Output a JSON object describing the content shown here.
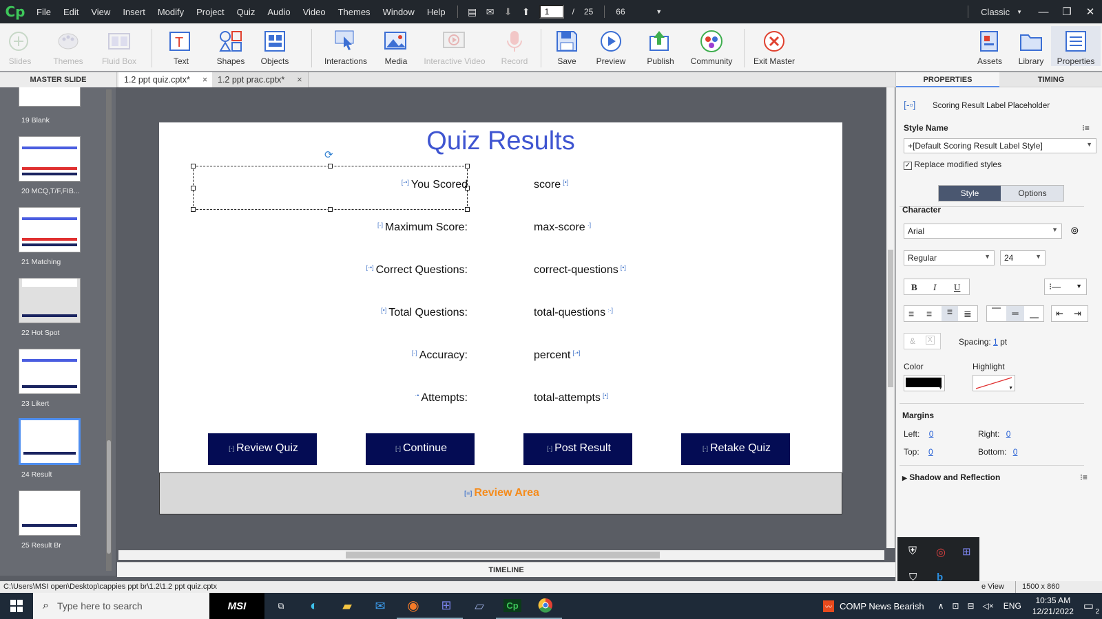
{
  "menubar": {
    "logo": "Cp",
    "items": [
      "File",
      "Edit",
      "View",
      "Insert",
      "Modify",
      "Project",
      "Quiz",
      "Audio",
      "Video",
      "Themes",
      "Window",
      "Help"
    ],
    "current_page": "1",
    "page_sep": "/",
    "total_pages": "25",
    "zoom": "66",
    "workspace": "Classic"
  },
  "toolbar": {
    "slides": "Slides",
    "themes": "Themes",
    "fluid_box": "Fluid Box",
    "text": "Text",
    "shapes": "Shapes",
    "objects": "Objects",
    "interactions": "Interactions",
    "media": "Media",
    "interactive_video": "Interactive Video",
    "record": "Record",
    "save": "Save",
    "preview": "Preview",
    "publish": "Publish",
    "community": "Community",
    "exit_master": "Exit Master",
    "assets": "Assets",
    "library": "Library",
    "properties": "Properties"
  },
  "tabs": {
    "master_slide": "MASTER SLIDE",
    "doc1": "1.2 ppt quiz.cptx*",
    "doc2": "1.2 ppt prac.cptx*",
    "close": "×"
  },
  "filmstrip": [
    {
      "label": "19 Blank"
    },
    {
      "label": "20 MCQ,T/F,FIB..."
    },
    {
      "label": "21 Matching"
    },
    {
      "label": "22 Hot Spot"
    },
    {
      "label": "23 Likert"
    },
    {
      "label": "24 Result"
    },
    {
      "label": "25 Result Br"
    }
  ],
  "slide": {
    "title": "Quiz Results",
    "rows": [
      {
        "label": "You Scored",
        "value": "score"
      },
      {
        "label": "Maximum Score:",
        "value": "max-score"
      },
      {
        "label": "Correct Questions:",
        "value": "correct-questions"
      },
      {
        "label": "Total Questions:",
        "value": "total-questions"
      },
      {
        "label": "Accuracy:",
        "value": "percent"
      },
      {
        "label": "Attempts:",
        "value": "total-attempts"
      }
    ],
    "buttons": [
      "Review Quiz",
      "Continue",
      "Post Result",
      "Retake Quiz"
    ],
    "review_area": "Review Area"
  },
  "timeline": "TIMELINE",
  "properties": {
    "tab_properties": "PROPERTIES",
    "tab_timing": "TIMING",
    "object_name": "Scoring Result Label Placeholder",
    "style_name_label": "Style Name",
    "style_name_value": "+[Default Scoring Result Label Style]",
    "replace_label": "Replace modified styles",
    "seg_style": "Style",
    "seg_options": "Options",
    "character": "Character",
    "font": "Arial",
    "weight": "Regular",
    "size": "24",
    "bold": "B",
    "italic": "I",
    "underline": "U",
    "spacing_label": "Spacing:",
    "spacing_value": "1",
    "spacing_unit": "pt",
    "color": "Color",
    "highlight": "Highlight",
    "margins": "Margins",
    "left": "Left:",
    "right": "Right:",
    "top": "Top:",
    "bottom": "Bottom:",
    "left_v": "0",
    "right_v": "0",
    "top_v": "0",
    "bottom_v": "0",
    "shadow": "Shadow and Reflection",
    "text_color": "#000000",
    "accent": "#5a8de8"
  },
  "statusbar": {
    "path": "C:\\Users\\MSI open\\Desktop\\cappies ppt br\\1.2\\1.2 ppt quiz.cptx",
    "view": "e View",
    "dims": "1500 x 860"
  },
  "taskbar": {
    "search_placeholder": "Type here to search",
    "weather": "COMP  News Bearish",
    "lang": "ENG",
    "time": "10:35 AM",
    "date": "12/21/2022",
    "notif": "2"
  }
}
